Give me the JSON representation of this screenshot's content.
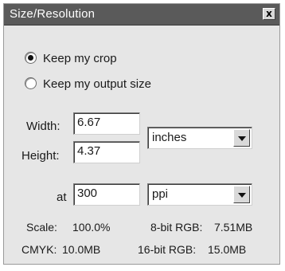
{
  "window": {
    "title": "Size/Resolution",
    "close_label": "x"
  },
  "crop_options": [
    {
      "label": "Keep my crop",
      "selected": true
    },
    {
      "label": "Keep my output size",
      "selected": false
    }
  ],
  "dimensions": {
    "width_label": "Width:",
    "width_value": "6.67",
    "height_label": "Height:",
    "height_value": "4.37",
    "unit_selected": "inches"
  },
  "resolution": {
    "at_label": "at",
    "value": "300",
    "unit_selected": "ppi"
  },
  "info": {
    "scale_label": "Scale:",
    "scale_value": "100.0%",
    "rgb8_label": "8-bit RGB:",
    "rgb8_value": "7.51MB",
    "cmyk_label": "CMYK:",
    "cmyk_value": "10.0MB",
    "rgb16_label": "16-bit RGB:",
    "rgb16_value": "15.0MB"
  }
}
